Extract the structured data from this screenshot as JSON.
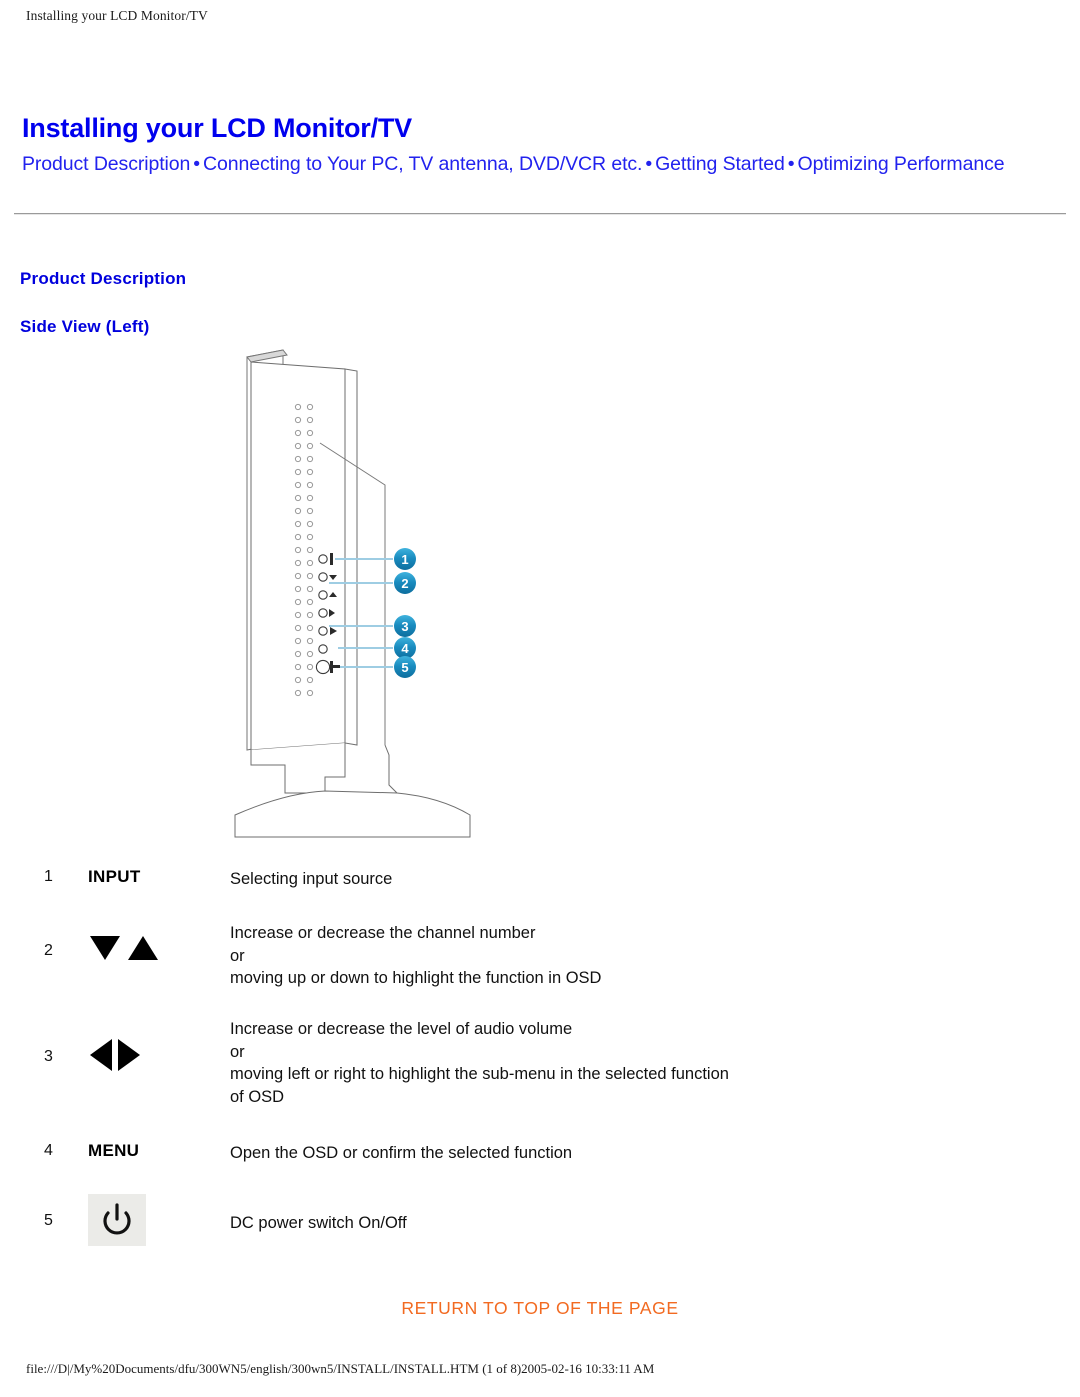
{
  "running_header": "Installing your LCD Monitor/TV",
  "page_title": "Installing your LCD Monitor/TV",
  "nav": {
    "separator": "•",
    "links": [
      {
        "label": "Product Description"
      },
      {
        "label": "Connecting to Your PC, TV antenna, DVD/VCR etc."
      },
      {
        "label": "Getting Started"
      },
      {
        "label": "Optimizing Performance"
      }
    ]
  },
  "headings": {
    "section": "Product Description",
    "subsection": "Side View (Left)"
  },
  "figure": {
    "caption_alt": "Side view (left) of LCD monitor showing control buttons",
    "callouts": [
      "1",
      "2",
      "3",
      "4",
      "5"
    ],
    "callout_color": "#1b8fc4"
  },
  "controls": {
    "rows": [
      {
        "num": "1",
        "key_label": "INPUT",
        "icon": "none",
        "desc_lines": [
          "Selecting input source"
        ]
      },
      {
        "num": "2",
        "key_label": "",
        "icon": "down-up-triangles",
        "desc_lines": [
          "Increase or decrease the channel number",
          "or",
          "moving up or down to highlight the function in OSD"
        ]
      },
      {
        "num": "3",
        "key_label": "",
        "icon": "left-right-triangles",
        "desc_lines": [
          "Increase or decrease the level of audio volume",
          "or",
          "moving left or right to highlight the sub-menu in the selected function",
          "of OSD"
        ]
      },
      {
        "num": "4",
        "key_label": "MENU",
        "icon": "none",
        "desc_lines": [
          "Open the OSD or confirm the selected function"
        ]
      },
      {
        "num": "5",
        "key_label": "",
        "icon": "power",
        "desc_lines": [
          "DC power switch On/Off"
        ]
      }
    ]
  },
  "footer": {
    "return_link": "RETURN TO TOP OF THE PAGE",
    "file_path": "file:///D|/My%20Documents/dfu/300WN5/english/300wn5/INSTALL/INSTALL.HTM (1 of 8)2005-02-16 10:33:11 AM"
  }
}
